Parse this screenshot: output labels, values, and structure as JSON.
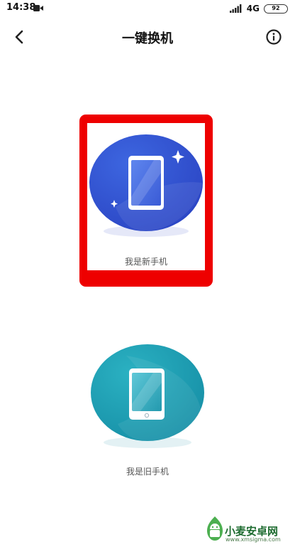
{
  "status_bar": {
    "time": "14:38",
    "network": "4G",
    "battery": "92"
  },
  "header": {
    "title": "一键换机"
  },
  "options": {
    "new_phone": {
      "label": "我是新手机",
      "color": "#3252d2"
    },
    "old_phone": {
      "label": "我是旧手机",
      "color": "#1a9aae"
    }
  },
  "highlight_color": "#ee0000",
  "watermark": {
    "text": "小麦安卓网",
    "url": "www.xmsigma.com"
  },
  "icons": {
    "back": "chevron-left-icon",
    "info": "info-circle-icon",
    "phone": "phone-icon",
    "sparkle": "sparkle-icon"
  }
}
